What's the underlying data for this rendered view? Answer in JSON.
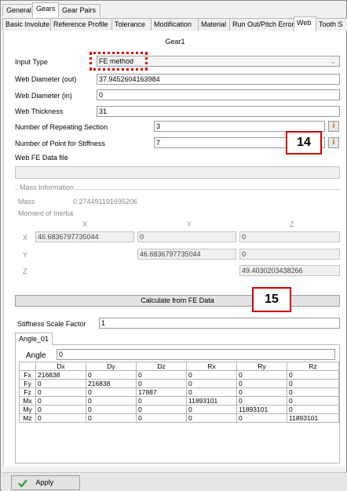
{
  "top_tabs": [
    "General",
    "Gears",
    "Gear Pairs"
  ],
  "sub_tabs": [
    "Basic Involute",
    "Reference Profile",
    "Tolerance",
    "Modification",
    "Material",
    "Run Out/Pitch Error",
    "Web",
    "Tooth S"
  ],
  "gear_title": "Gear1",
  "input_type": {
    "label": "Input Type",
    "value": "FE method"
  },
  "web_diameter_out": {
    "label": "Web Diameter (out)",
    "value": "37.9452604163984"
  },
  "web_diameter_in": {
    "label": "Web Diameter (in)",
    "value": "0"
  },
  "web_thickness": {
    "label": "Web Thickness",
    "value": "31"
  },
  "repeating_section": {
    "label": "Number of Repeating Section",
    "value": "3"
  },
  "point_stiffness": {
    "label": "Number of Point for Stiffness",
    "value": "7"
  },
  "info_glyph": "i",
  "web_fe_label": "Web FE Data file",
  "mass_info": {
    "section": "Mass Information",
    "mass_label": "Mass",
    "mass_value": "0.274491191695206",
    "moi_label": "Moment of Inertia",
    "col_x": "X",
    "col_y": "Y",
    "col_z": "Z",
    "row_x": "X",
    "row_y": "Y",
    "row_z": "Z",
    "xx": "46.6836797735044",
    "xy": "0",
    "xz": "0",
    "yy": "46.6836797735044",
    "yz": "0",
    "zz": "49.4030203438266"
  },
  "calc_button": "Calculate from FE Data",
  "callout_14": "14",
  "callout_15": "15",
  "stiffness_scale": {
    "label": "Stiffness Scale Factor",
    "value": "1"
  },
  "angle_tab": "Angle_01",
  "angle": {
    "label": "Angle",
    "value": "0"
  },
  "matrix": {
    "columns": [
      "Dx",
      "Dy",
      "Dz",
      "Rx",
      "Ry",
      "Rz"
    ],
    "rows": [
      {
        "name": "Fx",
        "values": [
          "216838",
          "0",
          "0",
          "0",
          "0",
          "0"
        ]
      },
      {
        "name": "Fy",
        "values": [
          "0",
          "216838",
          "0",
          "0",
          "0",
          "0"
        ]
      },
      {
        "name": "Fz",
        "values": [
          "0",
          "0",
          "17887",
          "0",
          "0",
          "0"
        ]
      },
      {
        "name": "Mx",
        "values": [
          "0",
          "0",
          "0",
          "11893101",
          "0",
          "0"
        ]
      },
      {
        "name": "My",
        "values": [
          "0",
          "0",
          "0",
          "0",
          "11893101",
          "0"
        ]
      },
      {
        "name": "Mz",
        "values": [
          "0",
          "0",
          "0",
          "0",
          "0",
          "11893101"
        ]
      }
    ]
  },
  "apply_button": "Apply",
  "colors": {
    "callout_border": "#d00000",
    "check_green": "#2a9a2a"
  }
}
